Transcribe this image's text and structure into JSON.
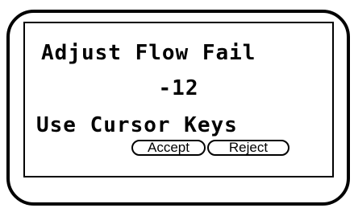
{
  "display": {
    "line1": "Adjust Flow Fail",
    "line2": "-12",
    "line3": "Use Cursor Keys"
  },
  "buttons": {
    "accept_label": "Accept",
    "reject_label": "Reject"
  }
}
